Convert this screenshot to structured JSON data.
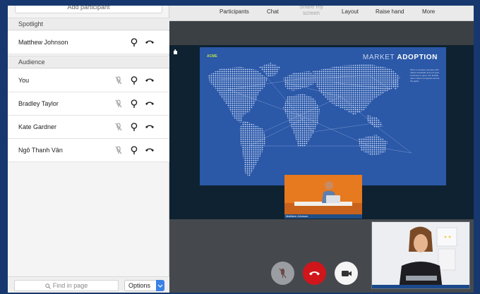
{
  "sidebar": {
    "add_participant_label": "Add participant",
    "spotlight_header": "Spotlight",
    "audience_header": "Audience",
    "spotlight": [
      {
        "name": "Matthew Johnson"
      }
    ],
    "audience": [
      {
        "name": "You"
      },
      {
        "name": "Bradley Taylor"
      },
      {
        "name": "Kate Gardner"
      },
      {
        "name": "Ngô Thanh Vân"
      }
    ],
    "find_placeholder": "Find in page",
    "options_label": "Options"
  },
  "toolbar": {
    "participants": "Participants",
    "chat": "Chat",
    "share_screen": "Share my screen",
    "layout": "Layout",
    "raise_hand": "Raise hand",
    "more": "More"
  },
  "slide": {
    "brand": "ACME",
    "title_light": "MARKET",
    "title_bold": "ADOPTION",
    "blurb": "We're a creative company with offices worldwide and our team continues to grow. Our flexible team makes companies across the globe."
  },
  "speaker_tile": {
    "name": "Matthew Johnson"
  },
  "colors": {
    "background": "#17386e",
    "slide": "#2b58a7",
    "end_call": "#d0161b",
    "accent": "#3b82e6",
    "speaker_tile": "#e77a25"
  }
}
